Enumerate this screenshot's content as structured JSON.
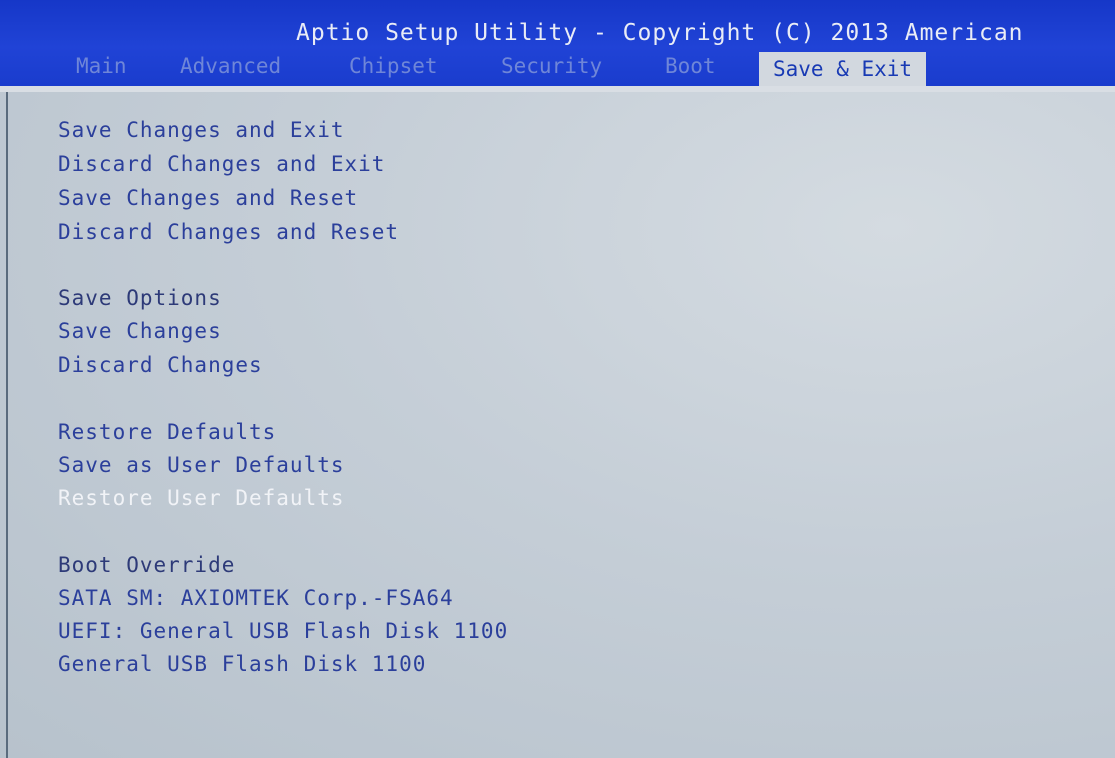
{
  "header": {
    "title": "Aptio Setup Utility - Copyright (C) 2013 American"
  },
  "tabs": [
    {
      "label": "Main"
    },
    {
      "label": "Advanced"
    },
    {
      "label": "Chipset"
    },
    {
      "label": "Security"
    },
    {
      "label": "Boot"
    },
    {
      "label": "Save & Exit"
    }
  ],
  "active_tab": "Save & Exit",
  "menu": {
    "save_changes_and_exit": "Save Changes and Exit",
    "discard_changes_and_exit": "Discard Changes and Exit",
    "save_changes_and_reset": "Save Changes and Reset",
    "discard_changes_and_reset": "Discard Changes and Reset",
    "save_options_heading": "Save Options",
    "save_changes": "Save Changes",
    "discard_changes": "Discard Changes",
    "restore_defaults": "Restore Defaults",
    "save_as_user_defaults": "Save as User Defaults",
    "restore_user_defaults": "Restore User Defaults",
    "boot_override_heading": "Boot Override",
    "boot_sata": "SATA  SM: AXIOMTEK Corp.-FSA64",
    "boot_uefi_usb": "UEFI: General USB Flash Disk 1100",
    "boot_usb": "General USB Flash Disk 1100"
  },
  "selected_item": "Restore User Defaults",
  "colors": {
    "header_bg": "#1a3ccd",
    "header_text": "#e9ecf6",
    "content_bg": "#c5ced7",
    "item_text": "#2b3f9b",
    "selected_text": "#f1f3f7"
  }
}
